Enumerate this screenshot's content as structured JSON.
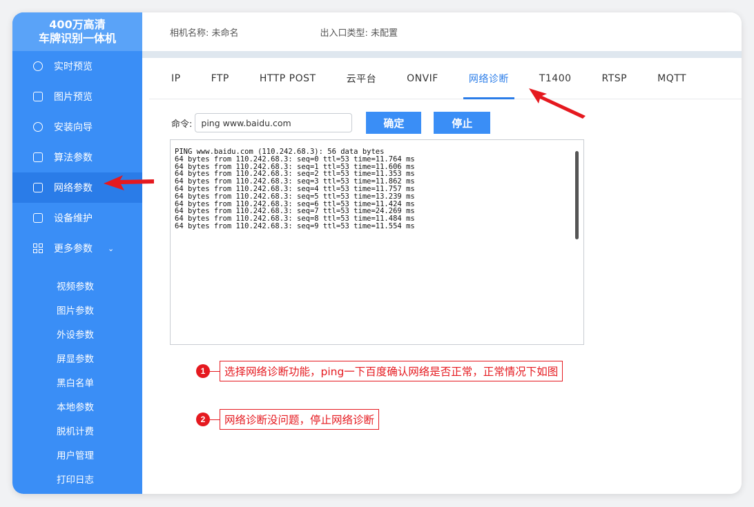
{
  "brand": {
    "line1": "400万高清",
    "line2": "车牌识别一体机"
  },
  "nav": [
    {
      "label": "实时预览",
      "icon": "refresh-icon"
    },
    {
      "label": "图片预览",
      "icon": "image-icon"
    },
    {
      "label": "安装向导",
      "icon": "wrench-icon"
    },
    {
      "label": "算法参数",
      "icon": "edit-icon"
    },
    {
      "label": "网络参数",
      "icon": "network-icon",
      "active": true
    },
    {
      "label": "设备维护",
      "icon": "monitor-icon"
    },
    {
      "label": "更多参数",
      "icon": "grid-icon"
    }
  ],
  "sub_nav": [
    "视频参数",
    "图片参数",
    "外设参数",
    "屏显参数",
    "黑白名单",
    "本地参数",
    "脱机计费",
    "用户管理",
    "打印日志"
  ],
  "header": {
    "camera_name": "相机名称: 未命名",
    "port_type": "出入口类型: 未配置"
  },
  "tabs": [
    "IP",
    "FTP",
    "HTTP POST",
    "云平台",
    "ONVIF",
    "网络诊断",
    "T1400",
    "RTSP",
    "MQTT"
  ],
  "active_tab": "网络诊断",
  "command": {
    "label": "命令:",
    "value": "ping www.baidu.com",
    "ok_label": "确定",
    "stop_label": "停止"
  },
  "console_lines": [
    "PING www.baidu.com (110.242.68.3): 56 data bytes",
    "64 bytes from 110.242.68.3: seq=0 ttl=53 time=11.764 ms",
    "64 bytes from 110.242.68.3: seq=1 ttl=53 time=11.606 ms",
    "64 bytes from 110.242.68.3: seq=2 ttl=53 time=11.353 ms",
    "64 bytes from 110.242.68.3: seq=3 ttl=53 time=11.862 ms",
    "64 bytes from 110.242.68.3: seq=4 ttl=53 time=11.757 ms",
    "64 bytes from 110.242.68.3: seq=5 ttl=53 time=13.239 ms",
    "64 bytes from 110.242.68.3: seq=6 ttl=53 time=11.424 ms",
    "64 bytes from 110.242.68.3: seq=7 ttl=53 time=24.269 ms",
    "64 bytes from 110.242.68.3: seq=8 ttl=53 time=11.484 ms",
    "64 bytes from 110.242.68.3: seq=9 ttl=53 time=11.554 ms"
  ],
  "annotations": [
    {
      "num": "1",
      "text": "选择网络诊断功能，ping一下百度确认网络是否正常，正常情况下如图"
    },
    {
      "num": "2",
      "text": "网络诊断没问题，停止网络诊断"
    }
  ],
  "colors": {
    "primary": "#3a8ef6",
    "active": "#2a7ce8",
    "annotation": "#e5191f"
  }
}
